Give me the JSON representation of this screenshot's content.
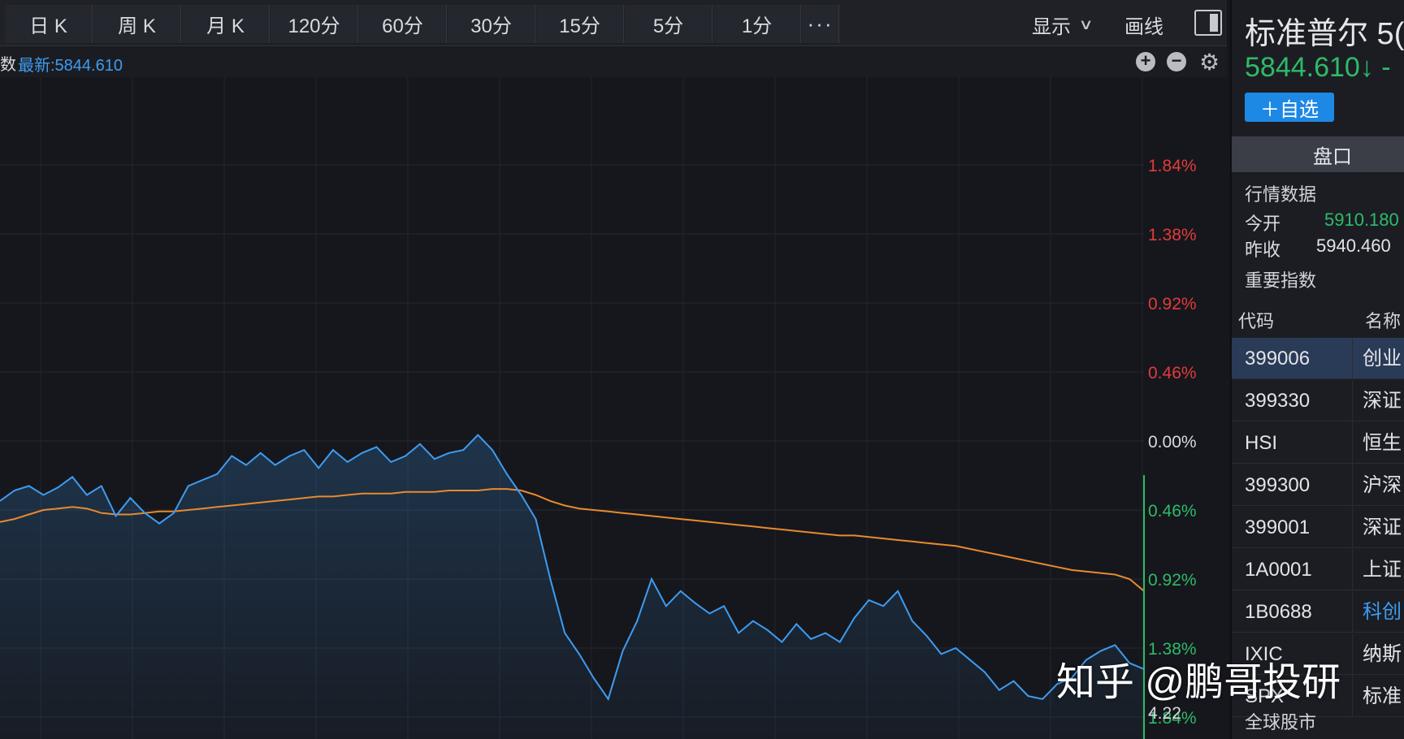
{
  "toolbar": {
    "tabs": [
      {
        "label": "日 K"
      },
      {
        "label": "周 K"
      },
      {
        "label": "月 K"
      },
      {
        "label": "120分"
      },
      {
        "label": "60分"
      },
      {
        "label": "30分"
      },
      {
        "label": "15分"
      },
      {
        "label": "5分"
      },
      {
        "label": "1分"
      },
      {
        "label": "···"
      }
    ],
    "display_label": "显示",
    "draw_label": "画线"
  },
  "info": {
    "index_cut": "数",
    "latest_label": "最新:5844.610"
  },
  "chart_data": {
    "type": "line",
    "title": "",
    "xlabel": "",
    "ylabel": "",
    "y_right_tick_labels": [
      {
        "text": "1.84%",
        "color": "#e23b3b"
      },
      {
        "text": "1.38%",
        "color": "#e23b3b"
      },
      {
        "text": "0.92%",
        "color": "#e23b3b"
      },
      {
        "text": "0.46%",
        "color": "#e23b3b"
      },
      {
        "text": "0.00%",
        "color": "#d7d9de"
      },
      {
        "text": "0.46%",
        "color": "#2dbb6a"
      },
      {
        "text": "0.92%",
        "color": "#2dbb6a"
      },
      {
        "text": "1.38%",
        "color": "#2dbb6a"
      },
      {
        "text": "1.84%",
        "color": "#2dbb6a"
      }
    ],
    "ylim_pct": [
      -1.84,
      1.84
    ],
    "volume_label": "4.22",
    "grid": true,
    "series": [
      {
        "role": "price",
        "color": "#3d9cf2",
        "values": [
          -0.4,
          -0.33,
          -0.3,
          -0.36,
          -0.31,
          -0.24,
          -0.36,
          -0.3,
          -0.5,
          -0.38,
          -0.48,
          -0.55,
          -0.48,
          -0.3,
          -0.26,
          -0.22,
          -0.1,
          -0.16,
          -0.08,
          -0.16,
          -0.1,
          -0.06,
          -0.18,
          -0.06,
          -0.14,
          -0.08,
          -0.04,
          -0.14,
          -0.1,
          -0.02,
          -0.12,
          -0.08,
          -0.06,
          0.04,
          -0.06,
          -0.22,
          -0.36,
          -0.52,
          -0.92,
          -1.28,
          -1.42,
          -1.58,
          -1.72,
          -1.4,
          -1.2,
          -0.92,
          -1.1,
          -1.0,
          -1.08,
          -1.15,
          -1.1,
          -1.28,
          -1.2,
          -1.26,
          -1.34,
          -1.22,
          -1.32,
          -1.28,
          -1.34,
          -1.18,
          -1.06,
          -1.1,
          -1.0,
          -1.2,
          -1.3,
          -1.42,
          -1.38,
          -1.46,
          -1.54,
          -1.66,
          -1.6,
          -1.7,
          -1.72,
          -1.62,
          -1.58,
          -1.46,
          -1.4,
          -1.36,
          -1.48,
          -1.52
        ]
      },
      {
        "role": "average",
        "color": "#e88a2e",
        "values": [
          -0.54,
          -0.52,
          -0.49,
          -0.46,
          -0.45,
          -0.44,
          -0.45,
          -0.48,
          -0.49,
          -0.49,
          -0.48,
          -0.47,
          -0.47,
          -0.46,
          -0.45,
          -0.44,
          -0.43,
          -0.42,
          -0.41,
          -0.4,
          -0.39,
          -0.38,
          -0.37,
          -0.37,
          -0.36,
          -0.35,
          -0.35,
          -0.35,
          -0.34,
          -0.34,
          -0.34,
          -0.33,
          -0.33,
          -0.33,
          -0.32,
          -0.32,
          -0.33,
          -0.36,
          -0.4,
          -0.43,
          -0.45,
          -0.46,
          -0.47,
          -0.48,
          -0.49,
          -0.5,
          -0.51,
          -0.52,
          -0.53,
          -0.54,
          -0.55,
          -0.56,
          -0.57,
          -0.58,
          -0.59,
          -0.6,
          -0.61,
          -0.62,
          -0.63,
          -0.63,
          -0.64,
          -0.65,
          -0.66,
          -0.67,
          -0.68,
          -0.69,
          -0.7,
          -0.72,
          -0.74,
          -0.76,
          -0.78,
          -0.8,
          -0.82,
          -0.84,
          -0.86,
          -0.87,
          -0.88,
          -0.89,
          -0.92,
          -1.0
        ]
      }
    ]
  },
  "panel": {
    "name": "标准普尔 5(",
    "price": "5844.610↓ -",
    "add_watch": "＋自选",
    "pankou_tab": "盘口",
    "market_data_title": "行情数据",
    "open_label": "今开",
    "open_value": "5910.180",
    "prev_close_label": "昨收",
    "prev_close_value": "5940.460",
    "key_index_title": "重要指数",
    "col_code": "代码",
    "col_name": "名称",
    "rows": [
      {
        "code": "399006",
        "name": "创业",
        "name_color": "#e2e4e8",
        "selected": true
      },
      {
        "code": "399330",
        "name": "深证",
        "name_color": "#e2e4e8",
        "selected": false
      },
      {
        "code": "HSI",
        "name": "恒生",
        "name_color": "#e2e4e8",
        "selected": false
      },
      {
        "code": "399300",
        "name": "沪深",
        "name_color": "#e2e4e8",
        "selected": false
      },
      {
        "code": "399001",
        "name": "深证",
        "name_color": "#e2e4e8",
        "selected": false
      },
      {
        "code": "1A0001",
        "name": "上证",
        "name_color": "#e2e4e8",
        "selected": false
      },
      {
        "code": "1B0688",
        "name": "科创",
        "name_color": "#3d9cf2",
        "selected": false
      },
      {
        "code": "IXIC",
        "name": "纳斯",
        "name_color": "#e2e4e8",
        "selected": false
      },
      {
        "code": "SPX",
        "name": "标准",
        "name_color": "#e2e4e8",
        "selected": false
      }
    ],
    "global_title": "全球股市"
  },
  "watermark": "知乎 @鹏哥投研",
  "colors": {
    "up": "#e23b3b",
    "down": "#2dbb6a",
    "accent": "#1e88e5"
  }
}
